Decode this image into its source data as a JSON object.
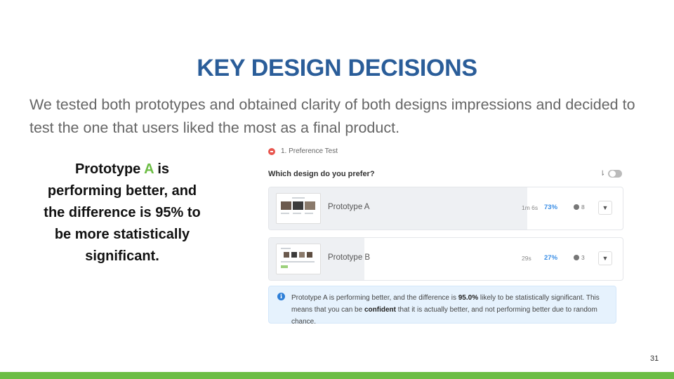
{
  "slide": {
    "title": "KEY DESIGN DECISIONS",
    "subtitle": "We tested both prototypes and obtained clarity of both designs impressions and decided to test the one that users liked the most as a final product.",
    "callout": {
      "before": "Prototype ",
      "accent": "A",
      "after": " is performing better, and the difference is 95% to be more statistically significant."
    },
    "page_number": "31",
    "accent_color": "#6cbd45",
    "title_color": "#2a5d99"
  },
  "test": {
    "header": "1. Preference Test",
    "question": "Which design do you prefer?",
    "rows": [
      {
        "label": "Prototype A",
        "time": "1m 6s",
        "percent": "73%",
        "share": 0.73,
        "users": "8"
      },
      {
        "label": "Prototype B",
        "time": "29s",
        "percent": "27%",
        "share": 0.27,
        "users": "3"
      }
    ],
    "info": {
      "t1": "Prototype A is performing better, and the difference is ",
      "b1": "95.0%",
      "t2": " likely to be statistically significant. This means that you can be ",
      "b2": "confident",
      "t3": " that it is actually better, and not performing better due to random chance."
    }
  },
  "icons": {
    "test_status": "record-icon",
    "sort": "sort-icon",
    "user": "user-icon",
    "filter": "filter-icon",
    "info": "info-icon"
  }
}
